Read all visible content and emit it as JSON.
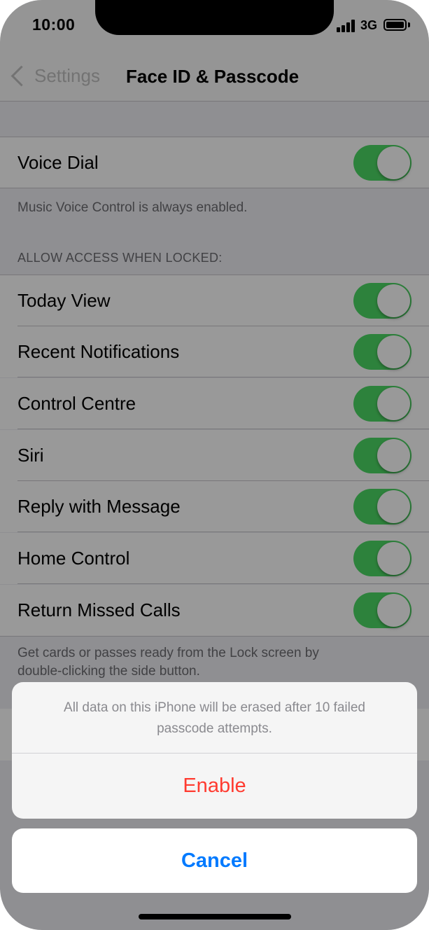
{
  "status_bar": {
    "time": "10:00",
    "network": "3G"
  },
  "nav": {
    "back_label": "Settings",
    "title": "Face ID & Passcode"
  },
  "voice_dial": {
    "label": "Voice Dial",
    "on": true,
    "footer": "Music Voice Control is always enabled."
  },
  "locked_access": {
    "header": "ALLOW ACCESS WHEN LOCKED:",
    "items": [
      {
        "label": "Today View",
        "on": true
      },
      {
        "label": "Recent Notifications",
        "on": true
      },
      {
        "label": "Control Centre",
        "on": true
      },
      {
        "label": "Siri",
        "on": true
      },
      {
        "label": "Reply with Message",
        "on": true
      },
      {
        "label": "Home Control",
        "on": true
      },
      {
        "label": "Return Missed Calls",
        "on": true
      }
    ],
    "footer_line1": "Get cards or passes ready from the Lock screen by",
    "footer_line2": "double-clicking the side button."
  },
  "action_sheet": {
    "message_line1": "All data on this iPhone will be erased after 10 failed",
    "message_line2": "passcode attempts.",
    "enable_label": "Enable",
    "cancel_label": "Cancel"
  },
  "colors": {
    "toggle_on": "#4cd964",
    "destructive": "#ff3b30",
    "accent": "#007aff",
    "background": "#efeff4"
  }
}
